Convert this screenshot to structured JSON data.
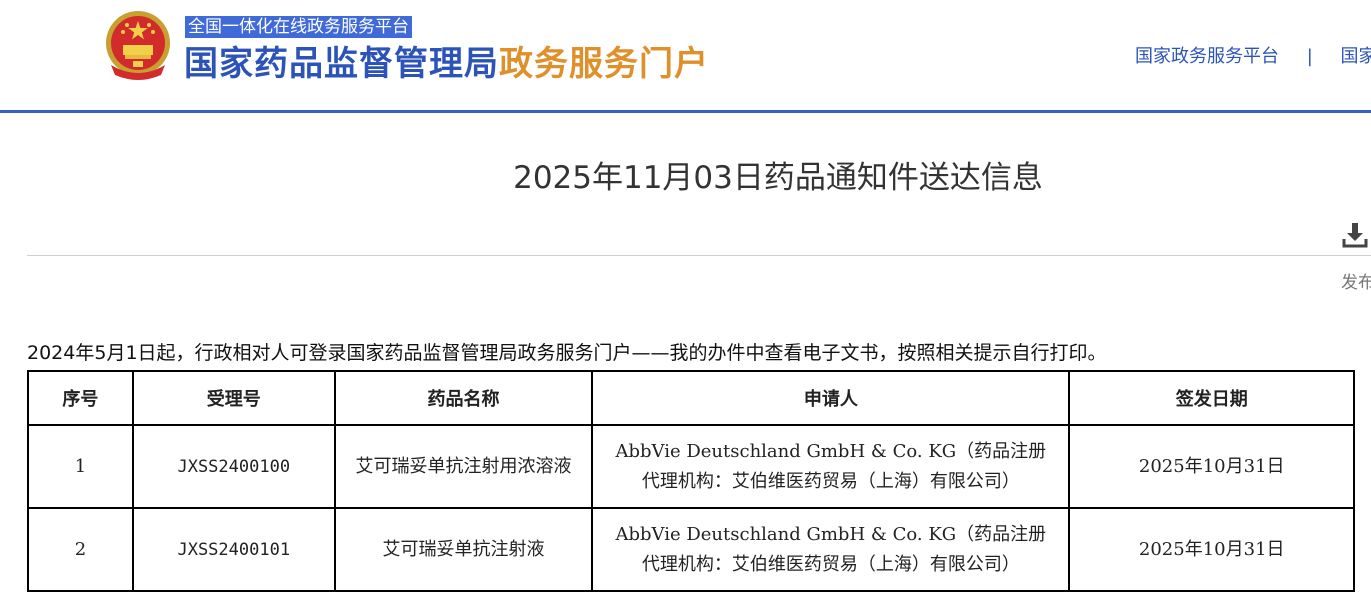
{
  "header": {
    "slogan": "全国一体化在线政务服务平台",
    "title_main": "国家药品监督管理局",
    "title_sub": "政务服务门户",
    "links": [
      {
        "label": "国家政务服务平台"
      },
      {
        "label": "|"
      },
      {
        "label": "国家"
      }
    ],
    "colors": {
      "brand_blue": "#2c54b8",
      "brand_orange": "#e0902a",
      "slogan_bg": "#3f6ad8"
    }
  },
  "page": {
    "title": "2025年11月03日药品通知件送达信息",
    "publish_label": "发布",
    "download_icon": "download-icon",
    "notice": "2024年5月1日起，行政相对人可登录国家药品监督管理局政务服务门户——我的办件中查看电子文书，按照相关提示自行打印。"
  },
  "table": {
    "headers": [
      "序号",
      "受理号",
      "药品名称",
      "申请人",
      "签发日期"
    ],
    "rows": [
      {
        "index": "1",
        "accept_no": "JXSS2400100",
        "drug_name": "艾可瑞妥单抗注射用浓溶液",
        "applicant": "AbbVie Deutschland GmbH & Co. KG（药品注册代理机构：艾伯维医药贸易（上海）有限公司）",
        "issue_date": "2025年10月31日"
      },
      {
        "index": "2",
        "accept_no": "JXSS2400101",
        "drug_name": "艾可瑞妥单抗注射液",
        "applicant": "AbbVie Deutschland GmbH & Co. KG（药品注册代理机构：艾伯维医药贸易（上海）有限公司）",
        "issue_date": "2025年10月31日"
      }
    ]
  }
}
